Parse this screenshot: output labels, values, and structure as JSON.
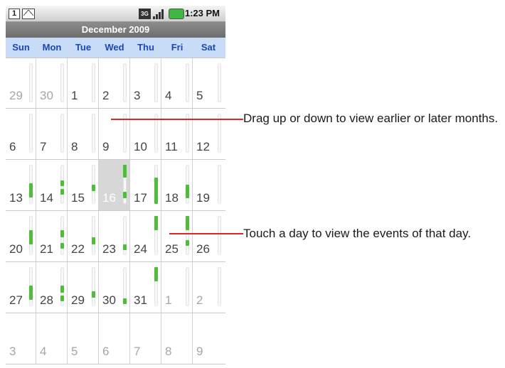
{
  "statusbar": {
    "cal_icon": "1",
    "net": "3G",
    "time": "1:23 PM"
  },
  "calendar": {
    "month_title": "December 2009",
    "weekdays": [
      "Sun",
      "Mon",
      "Tue",
      "Wed",
      "Thu",
      "Fri",
      "Sat"
    ],
    "weeks": [
      [
        "29",
        "30",
        "1",
        "2",
        "3",
        "4",
        "5"
      ],
      [
        "6",
        "7",
        "8",
        "9",
        "10",
        "11",
        "12"
      ],
      [
        "13",
        "14",
        "15",
        "16",
        "17",
        "18",
        "19"
      ],
      [
        "20",
        "21",
        "22",
        "23",
        "24",
        "25",
        "26"
      ],
      [
        "27",
        "28",
        "29",
        "30",
        "31",
        "1",
        "2"
      ],
      [
        "3",
        "4",
        "5",
        "6",
        "7",
        "8",
        "9"
      ]
    ],
    "selected_day": "16"
  },
  "callouts": {
    "drag": "Drag up or down to view earlier or later months.",
    "touch": "Touch a day to view the events of that day."
  },
  "colors": {
    "accent": "#e1262b",
    "event": "#4cbf37",
    "weekday_text": "#1a47b5"
  }
}
